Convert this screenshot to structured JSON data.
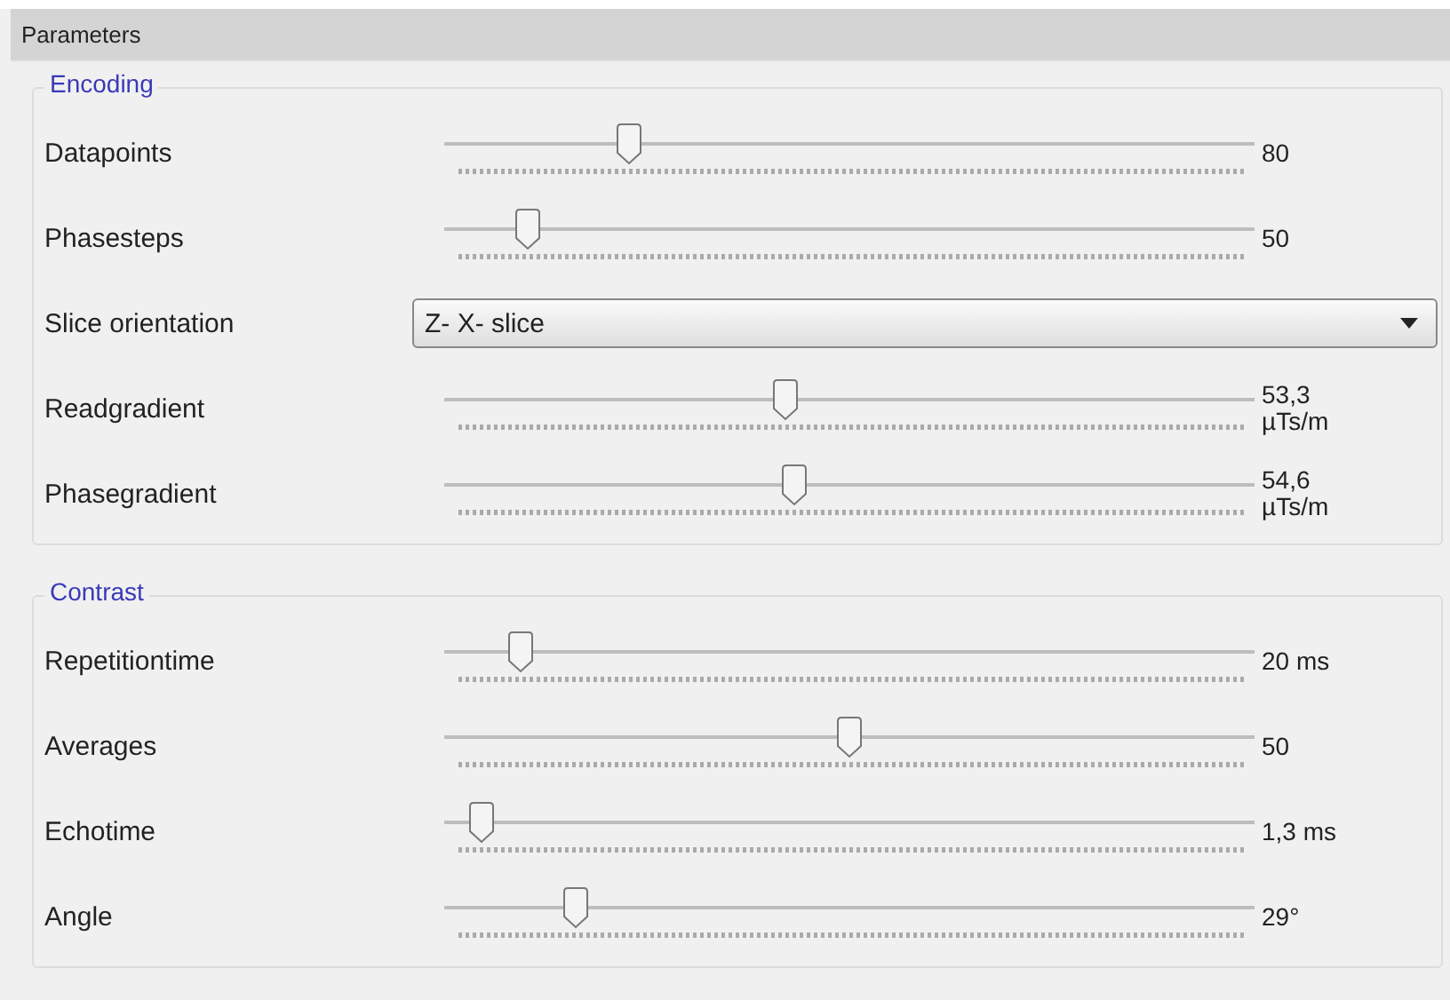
{
  "panel": {
    "title": "Parameters"
  },
  "sections": [
    {
      "title": "Encoding",
      "rows": [
        {
          "kind": "slider",
          "label": "Datapoints",
          "level": 0.21,
          "value": [
            "80"
          ]
        },
        {
          "kind": "slider",
          "label": "Phasesteps",
          "level": 0.08,
          "value": [
            "50"
          ]
        },
        {
          "kind": "dropdown",
          "label": "Slice orientation",
          "value": [
            "Z- X- slice"
          ]
        },
        {
          "kind": "slider",
          "label": "Readgradient",
          "level": 0.41,
          "value": [
            "53,3",
            "µTs/m"
          ]
        },
        {
          "kind": "slider",
          "label": "Phasegradient",
          "level": 0.42,
          "value": [
            "54,6",
            "µTs/m"
          ]
        }
      ]
    },
    {
      "title": "Contrast",
      "rows": [
        {
          "kind": "slider",
          "label": "Repetitiontime",
          "level": 0.07,
          "value": [
            "20 ms"
          ]
        },
        {
          "kind": "slider",
          "label": "Averages",
          "level": 0.49,
          "value": [
            "50"
          ]
        },
        {
          "kind": "slider",
          "label": "Echotime",
          "level": 0.02,
          "value": [
            "1,3 ms"
          ]
        },
        {
          "kind": "slider",
          "label": "Angle",
          "level": 0.14,
          "value": [
            "29°"
          ]
        }
      ]
    }
  ]
}
